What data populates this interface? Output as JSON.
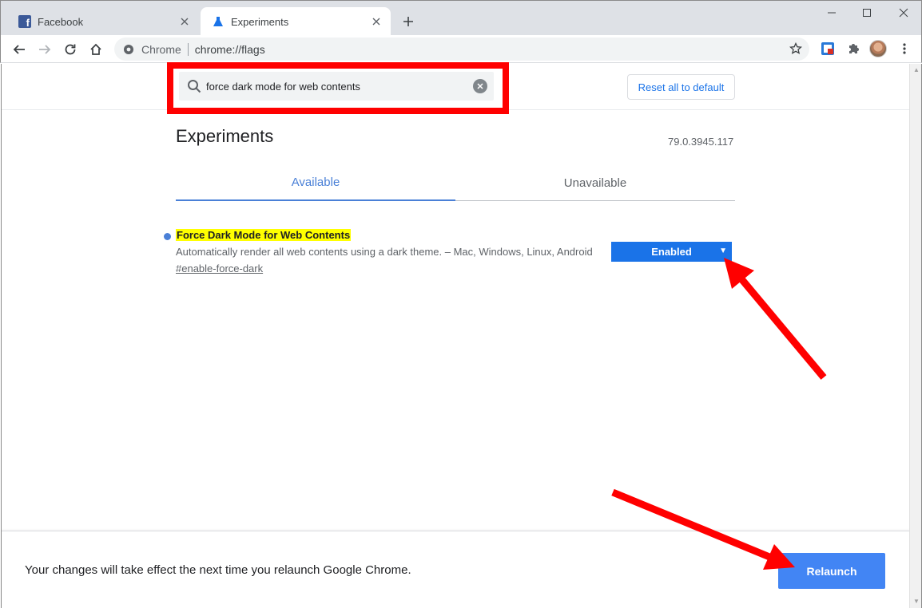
{
  "browser": {
    "tabs": [
      {
        "title": "Facebook",
        "icon": "facebook-icon",
        "active": false
      },
      {
        "title": "Experiments",
        "icon": "flask-icon",
        "active": true
      }
    ],
    "omnibox": {
      "scheme_label": "Chrome",
      "url": "chrome://flags"
    }
  },
  "flags_page": {
    "search_value": "force dark mode for web contents",
    "reset_label": "Reset all to default",
    "title": "Experiments",
    "version": "79.0.3945.117",
    "tabs": [
      "Available",
      "Unavailable"
    ],
    "flag": {
      "name": "Force Dark Mode for Web Contents",
      "description": "Automatically render all web contents using a dark theme. – Mac, Windows, Linux, Android",
      "link": "#enable-force-dark",
      "value": "Enabled"
    }
  },
  "footer": {
    "message": "Your changes will take effect the next time you relaunch Google Chrome.",
    "relaunch_label": "Relaunch"
  },
  "colors": {
    "accent": "#1a73e8",
    "highlight": "#ffff00",
    "annotation": "#ff0000",
    "relaunch": "#4285f4"
  }
}
